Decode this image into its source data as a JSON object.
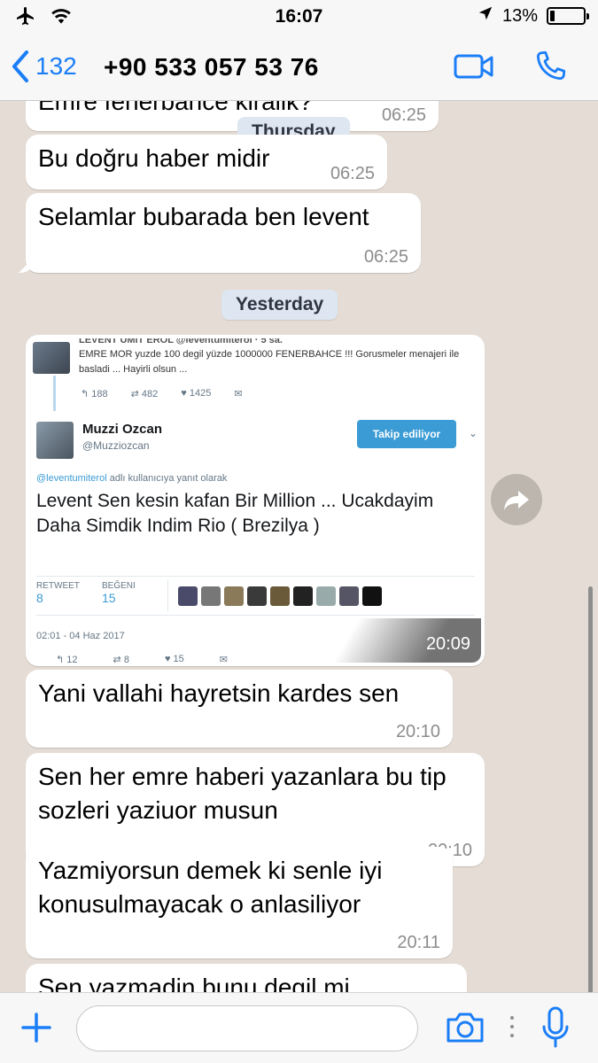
{
  "status_bar": {
    "time": "16:07",
    "battery": "13%",
    "battery_level": 0.13
  },
  "header": {
    "back_count": "132",
    "contact_name": "+90 533 057 53 76"
  },
  "chat": {
    "clipped_top_message": {
      "text": "Emre fenerbahce kiralik?",
      "time": "06:25"
    },
    "day_labels": {
      "thursday": "Thursday",
      "yesterday": "Yesterday"
    },
    "messages_thursday": [
      {
        "text": "Bu doğru haber midir",
        "time": "06:25"
      },
      {
        "text": "Selamlar bubarada ben levent",
        "time": "06:25"
      }
    ],
    "image_message": {
      "time": "20:09",
      "tweet": {
        "quoted_author": "LEVENT UMIT EROL @leventumiterol · 5 sa.",
        "quoted_text": "EMRE MOR yuzde 100 degil yüzde 1000000 FENERBAHCE !!! Gorusmeler menajeri ile basladi ... Hayirli olsun ...",
        "quoted_stats": {
          "replies": "188",
          "retweets": "482",
          "likes": "1425"
        },
        "author_name": "Muzzi Ozcan",
        "author_handle": "@Muzziozcan",
        "follow_label": "Takip ediliyor",
        "reply_context_user": "@leventumiterol",
        "reply_context_text": " adlı kullanıcıya yanıt olarak",
        "text": "Levent Sen kesin kafan Bir Million ... Ucakdayim Daha Simdik Indim Rio ( Brezilya )",
        "retweet_label": "RETWEET",
        "retweet_count": "8",
        "like_label": "BEĞENI",
        "like_count": "15",
        "date": "02:01 - 04 Haz 2017",
        "bottom_stats": {
          "replies": "12",
          "retweets": "8",
          "likes": "15"
        }
      }
    },
    "messages_yesterday": [
      {
        "text": "Yani vallahi hayretsin kardes sen",
        "time": "20:10"
      },
      {
        "text": "Sen her emre haberi yazanlara bu tip sozleri yaziuor musun",
        "time": "20:10"
      },
      {
        "text": "Yazmiyorsun demek ki senle iyi konusulmayacak o anlasiliyor",
        "time": "20:11"
      },
      {
        "text": "Sen yazmadin bunu degil mi"
      }
    ]
  },
  "input": {
    "value": "",
    "placeholder": ""
  },
  "colors": {
    "accent": "#1b7ef7",
    "chat_bg": "#e5ddd5",
    "bubble": "#ffffff",
    "day_pill": "#dde6f1",
    "follow_button": "#3a9bd5"
  },
  "icons": [
    "airplane-icon",
    "wifi-icon",
    "location-icon",
    "battery-icon",
    "back-chevron-icon",
    "video-call-icon",
    "phone-icon",
    "forward-icon",
    "plus-icon",
    "camera-icon",
    "microphone-icon"
  ]
}
